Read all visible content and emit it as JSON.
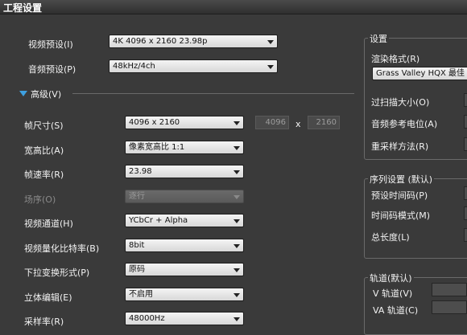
{
  "window": {
    "title": "工程设置"
  },
  "left": {
    "video_preset_label": "视频预设(I)",
    "video_preset_value": "4K 4096 x 2160 23.98p",
    "audio_preset_label": "音频预设(P)",
    "audio_preset_value": "48kHz/4ch",
    "advanced_label": "高级(V)",
    "frame_size_label": "帧尺寸(S)",
    "frame_size_value": "4096 x 2160",
    "frame_width": "4096",
    "frame_height": "2160",
    "frame_x": "x",
    "aspect_label": "宽高比(A)",
    "aspect_value": "像素宽高比 1:1",
    "framerate_label": "帧速率(R)",
    "framerate_value": "23.98",
    "field_order_label": "场序(O)",
    "field_order_value": "逐行",
    "video_channel_label": "视频通道(H)",
    "video_channel_value": "YCbCr + Alpha",
    "bitdepth_label": "视频量化比特率(B)",
    "bitdepth_value": "8bit",
    "pulldown_label": "下拉变换形式(P)",
    "pulldown_value": "原码",
    "stereo_label": "立体编辑(E)",
    "stereo_value": "不启用",
    "samplerate_label": "采样率(R)",
    "samplerate_value": "48000Hz"
  },
  "right": {
    "settings_title": "设置",
    "render_format_label": "渲染格式(R)",
    "render_format_value": "Grass Valley HQX 最佳",
    "overscan_label": "过扫描大小(O)",
    "audio_ref_label": "音频参考电位(A)",
    "resample_label": "重采样方法(R)",
    "sequence_title": "序列设置 (默认)",
    "preset_tc_label": "预设时间码(P)",
    "tc_mode_label": "时间码模式(M)",
    "total_length_label": "总长度(L)",
    "tracks_title": "轨道(默认)",
    "v_track_label": "V 轨道(V)",
    "va_track_label": "VA 轨道(C)"
  }
}
